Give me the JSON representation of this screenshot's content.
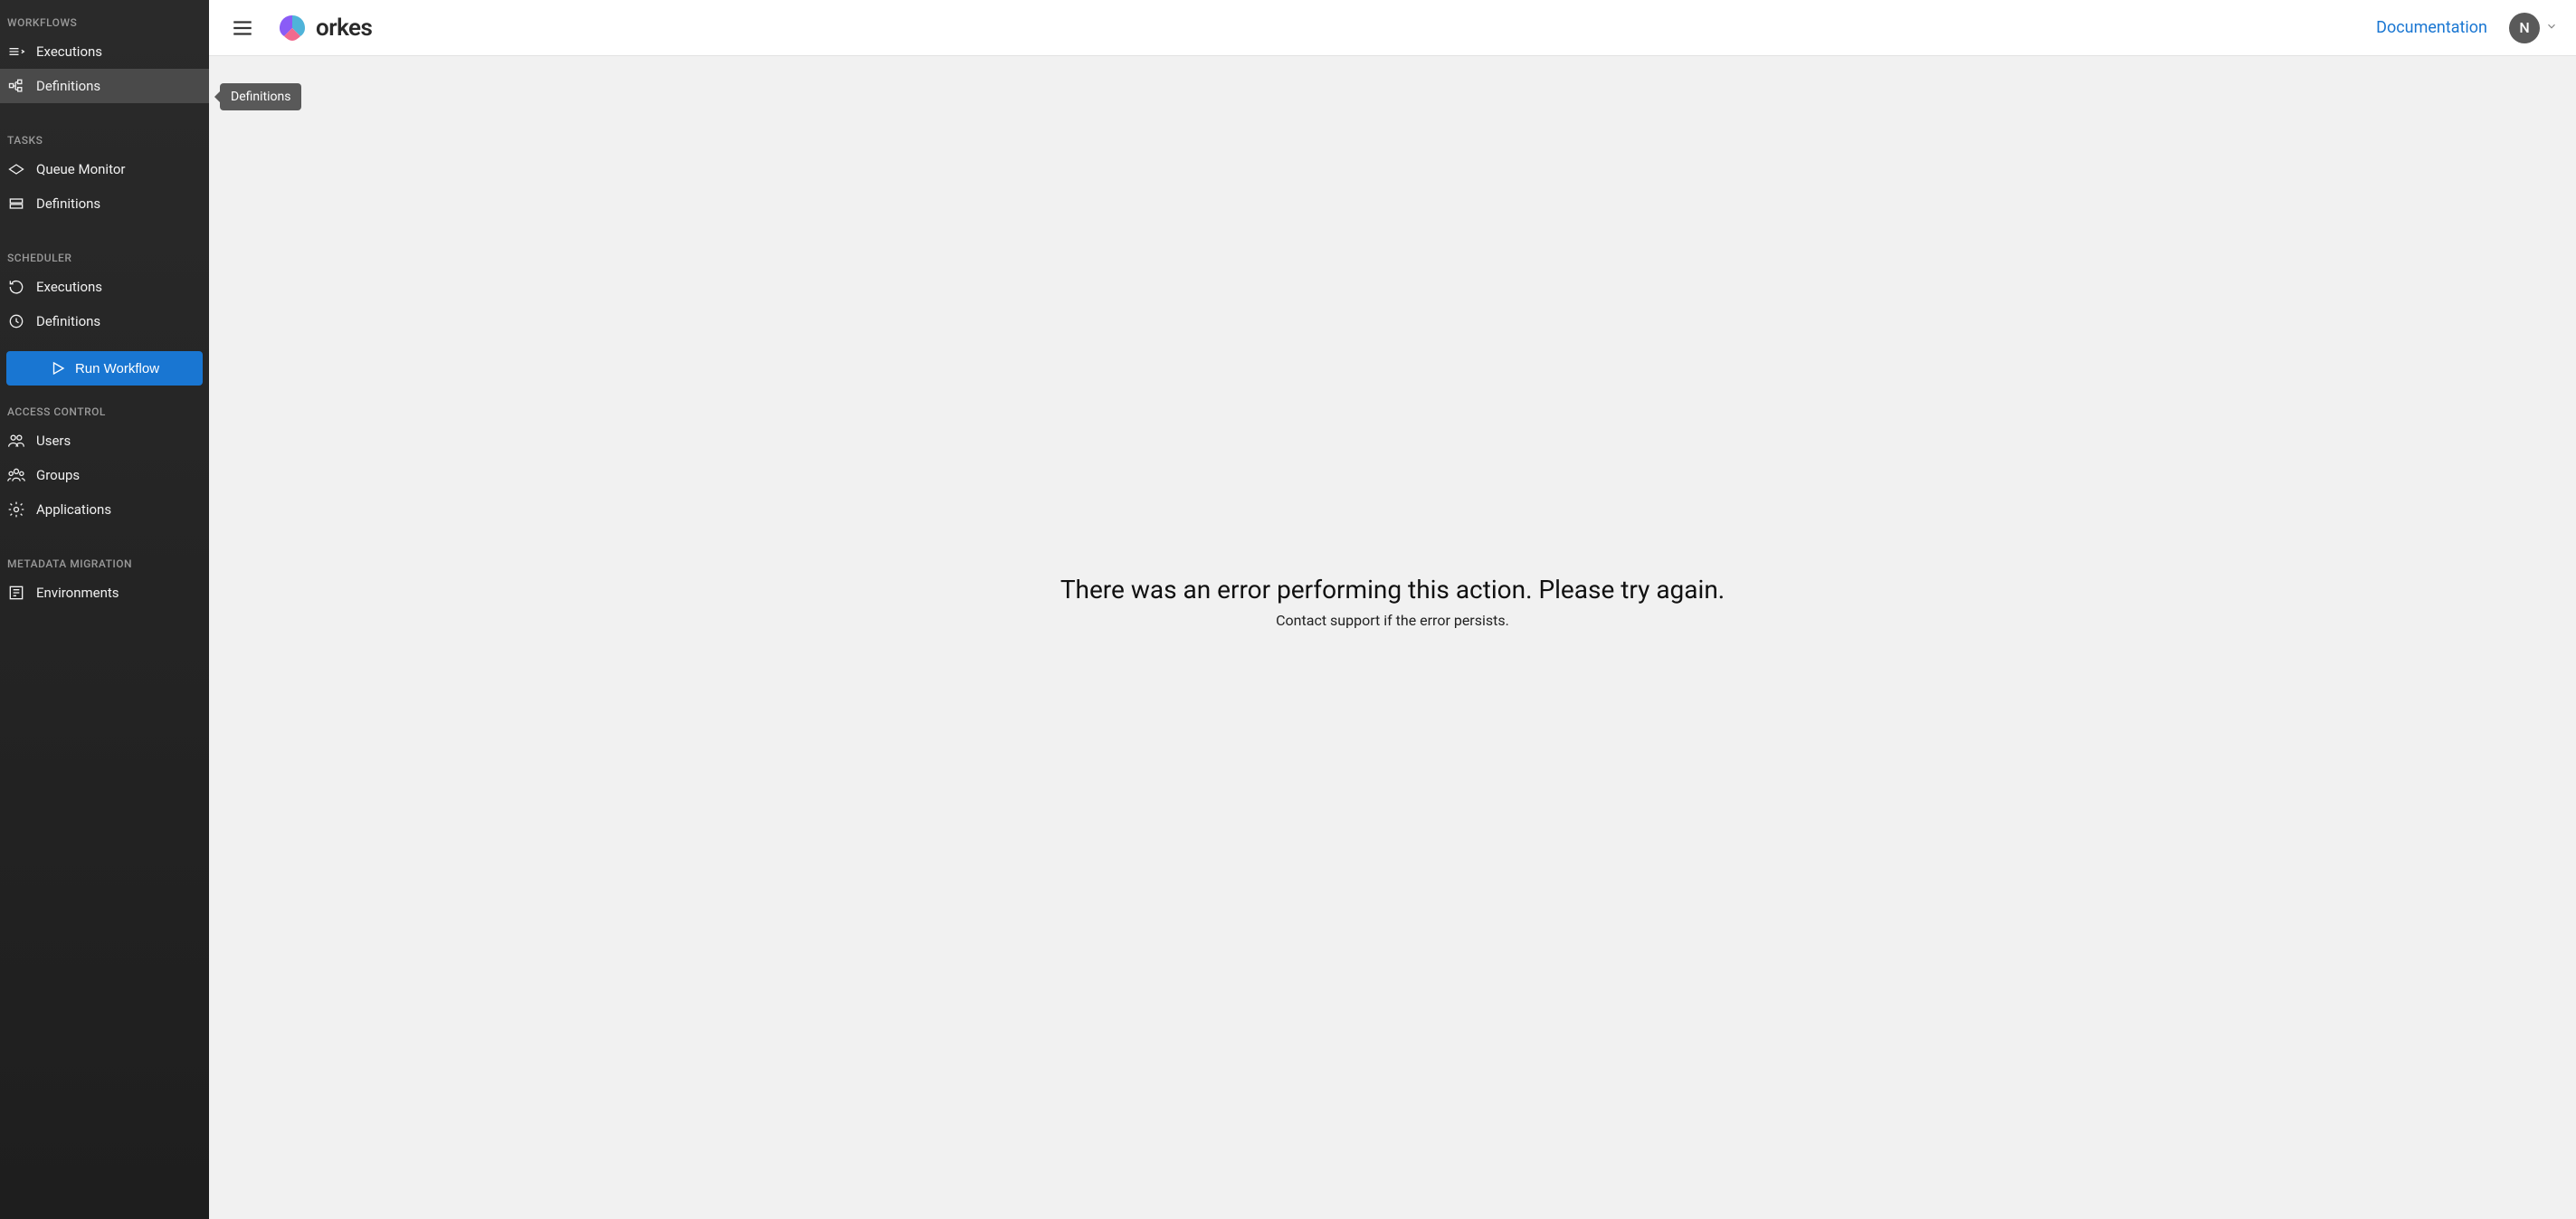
{
  "sidebar": {
    "sections": [
      {
        "header": "WORKFLOWS",
        "items": [
          {
            "label": "Executions",
            "icon": "executions",
            "active": false
          },
          {
            "label": "Definitions",
            "icon": "definitions",
            "active": true
          }
        ]
      },
      {
        "header": "TASKS",
        "items": [
          {
            "label": "Queue Monitor",
            "icon": "queue",
            "active": false
          },
          {
            "label": "Definitions",
            "icon": "taskdef",
            "active": false
          }
        ]
      },
      {
        "header": "SCHEDULER",
        "items": [
          {
            "label": "Executions",
            "icon": "sched-exec",
            "active": false
          },
          {
            "label": "Definitions",
            "icon": "clock",
            "active": false
          }
        ]
      }
    ],
    "run_button": "Run Workflow",
    "sections2": [
      {
        "header": "ACCESS CONTROL",
        "items": [
          {
            "label": "Users",
            "icon": "users",
            "active": false
          },
          {
            "label": "Groups",
            "icon": "groups",
            "active": false
          },
          {
            "label": "Applications",
            "icon": "gear",
            "active": false
          }
        ]
      },
      {
        "header": "METADATA MIGRATION",
        "items": [
          {
            "label": "Environments",
            "icon": "env",
            "active": false
          }
        ]
      }
    ]
  },
  "topbar": {
    "logo_text": "orkes",
    "documentation": "Documentation",
    "avatar_initial": "N"
  },
  "tooltip": {
    "text": "Definitions"
  },
  "content": {
    "error_title": "There was an error performing this action. Please try again.",
    "error_subtitle": "Contact support if the error persists."
  }
}
